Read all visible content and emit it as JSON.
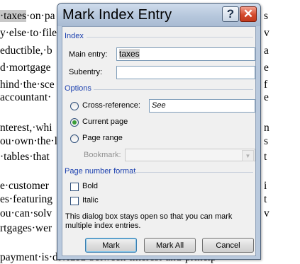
{
  "document": {
    "lines": [
      {
        "pre": "",
        "highlight": "·taxes",
        "post": "·on·pa"
      },
      {
        "pre": "y·else·to·file",
        "highlight": "",
        "post": ""
      },
      {
        "pre": "eductible,·b",
        "highlight": "",
        "post": ""
      },
      {
        "pre": "d·mortgage",
        "highlight": "",
        "post": ""
      },
      {
        "pre": "hind·the·sce",
        "highlight": "",
        "post": ""
      },
      {
        "pre": "accountant·",
        "highlight": "",
        "post": ""
      },
      {
        "pre": "nterest,·whi",
        "highlight": "",
        "post": ""
      },
      {
        "pre": "ou·own·the·l",
        "highlight": "",
        "post": ""
      },
      {
        "pre": "·tables·that",
        "highlight": "",
        "post": ""
      },
      {
        "pre": "e·customer",
        "highlight": "",
        "post": ""
      },
      {
        "pre": "es·featuring",
        "highlight": "",
        "post": ""
      },
      {
        "pre": "ou·can·solv",
        "highlight": "",
        "post": ""
      },
      {
        "pre": "rtgages·wer",
        "highlight": "",
        "post": ""
      },
      {
        "pre": "payment·is·divided·between·interest·and·princip",
        "highlight": "",
        "post": ""
      }
    ],
    "right_edge": [
      {
        "text": "s"
      },
      {
        "text": "v"
      },
      {
        "text": "a"
      },
      {
        "text": "e"
      },
      {
        "text": "f"
      },
      {
        "text": "e"
      },
      {
        "text": "n"
      },
      {
        "text": "s"
      },
      {
        "text": "t"
      },
      {
        "text": "i"
      },
      {
        "text": "t"
      },
      {
        "text": "v"
      }
    ]
  },
  "dialog": {
    "title": "Mark Index Entry",
    "help_label": "?",
    "close_label": "✕",
    "index_group": "Index",
    "main_entry_label": "Main entry:",
    "main_entry_value": "taxes",
    "subentry_label": "Subentry:",
    "subentry_value": "",
    "options_group": "Options",
    "cross_reference_label": "Cross-reference:",
    "cross_reference_value": "See",
    "current_page_label": "Current page",
    "current_page_selected": true,
    "page_range_label": "Page range",
    "bookmark_label": "Bookmark:",
    "bookmark_value": "",
    "page_number_format_group": "Page number format",
    "bold_label": "Bold",
    "bold_checked": false,
    "italic_label": "Italic",
    "italic_checked": false,
    "note": "This dialog box stays open so that you can mark multiple index entries.",
    "buttons": {
      "mark": "Mark",
      "mark_all": "Mark All",
      "cancel": "Cancel"
    }
  },
  "colors": {
    "group_header": "#1a3fae",
    "close_button": "#c0391d",
    "frame": "#b9c9dd"
  }
}
